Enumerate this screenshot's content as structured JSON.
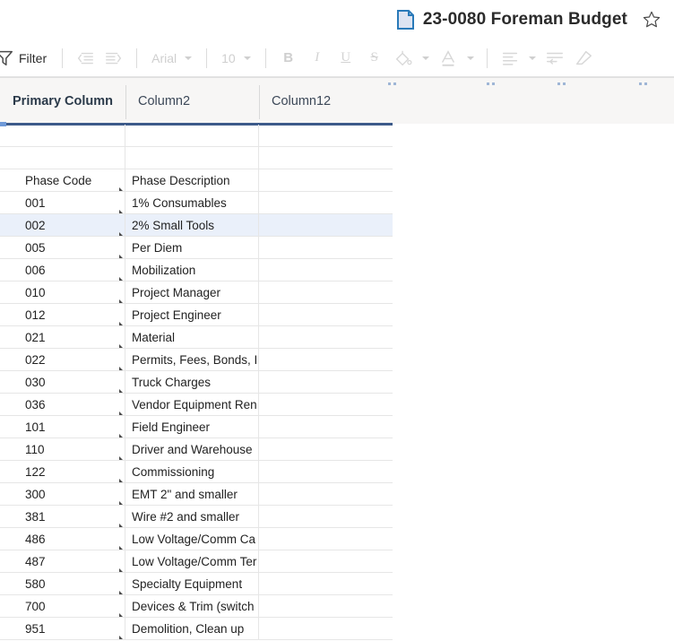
{
  "window": {
    "doc_icon": "sheet-document-icon",
    "title": "23-0080 Foreman Budget",
    "star_icon": "star-outline-icon"
  },
  "toolbar": {
    "filter": {
      "label": "Filter",
      "icon": "filter-funnel-icon"
    },
    "indent_decrease": {
      "icon": "decrease-indent-icon"
    },
    "indent_increase": {
      "icon": "increase-indent-icon"
    },
    "font_family": {
      "value": "Arial",
      "icon": "chevron-down-icon"
    },
    "font_size": {
      "value": "10",
      "icon": "chevron-down-icon"
    },
    "bold": {
      "label": "B",
      "icon": "bold-icon"
    },
    "italic": {
      "label": "I",
      "icon": "italic-icon"
    },
    "underline": {
      "label": "U",
      "icon": "underline-icon"
    },
    "strikethrough": {
      "label": "S",
      "icon": "strikethrough-icon"
    },
    "fill_color": {
      "icon": "fill-bucket-icon"
    },
    "text_color": {
      "icon": "text-color-a-icon"
    },
    "align": {
      "icon": "align-left-icon"
    },
    "wrap_text": {
      "icon": "wrap-text-icon"
    },
    "clear_format": {
      "icon": "eraser-icon"
    }
  },
  "grid": {
    "columns": [
      {
        "label": "Primary Column",
        "primary": true
      },
      {
        "label": "Column2",
        "primary": false
      },
      {
        "label": "Column12",
        "primary": false
      }
    ],
    "selected_row_index": 4,
    "rows": [
      {
        "c1": "",
        "c2": "",
        "c3": ""
      },
      {
        "c1": "",
        "c2": "",
        "c3": ""
      },
      {
        "c1": "Phase Code",
        "c2": "Phase Description",
        "c3": ""
      },
      {
        "c1": "001",
        "c2": "1% Consumables",
        "c3": ""
      },
      {
        "c1": "002",
        "c2": "2% Small Tools",
        "c3": ""
      },
      {
        "c1": "005",
        "c2": "Per Diem",
        "c3": ""
      },
      {
        "c1": "006",
        "c2": "Mobilization",
        "c3": ""
      },
      {
        "c1": "010",
        "c2": "Project Manager",
        "c3": ""
      },
      {
        "c1": "012",
        "c2": "Project Engineer",
        "c3": ""
      },
      {
        "c1": "021",
        "c2": "Material",
        "c3": ""
      },
      {
        "c1": "022",
        "c2": "Permits, Fees, Bonds, I",
        "c3": ""
      },
      {
        "c1": "030",
        "c2": "Truck Charges",
        "c3": ""
      },
      {
        "c1": "036",
        "c2": "Vendor Equipment Ren",
        "c3": ""
      },
      {
        "c1": "101",
        "c2": "Field Engineer",
        "c3": ""
      },
      {
        "c1": "110",
        "c2": "Driver and Warehouse",
        "c3": ""
      },
      {
        "c1": "122",
        "c2": "Commissioning",
        "c3": ""
      },
      {
        "c1": "300",
        "c2": "EMT 2\" and smaller",
        "c3": ""
      },
      {
        "c1": "381",
        "c2": "Wire #2 and smaller",
        "c3": ""
      },
      {
        "c1": "486",
        "c2": "Low Voltage/Comm Ca",
        "c3": ""
      },
      {
        "c1": "487",
        "c2": "Low Voltage/Comm Ter",
        "c3": ""
      },
      {
        "c1": "580",
        "c2": "Specialty Equipment",
        "c3": ""
      },
      {
        "c1": "700",
        "c2": "Devices & Trim (switch",
        "c3": ""
      },
      {
        "c1": "951",
        "c2": "Demolition, Clean up",
        "c3": ""
      }
    ]
  },
  "colors": {
    "accent_blue": "#3d5a8a",
    "selected_row": "#eaf0fa",
    "header_bg": "#f7f6f5",
    "icon_blue": "#2a7ab9",
    "disabled_gray": "#d3d3d3"
  }
}
